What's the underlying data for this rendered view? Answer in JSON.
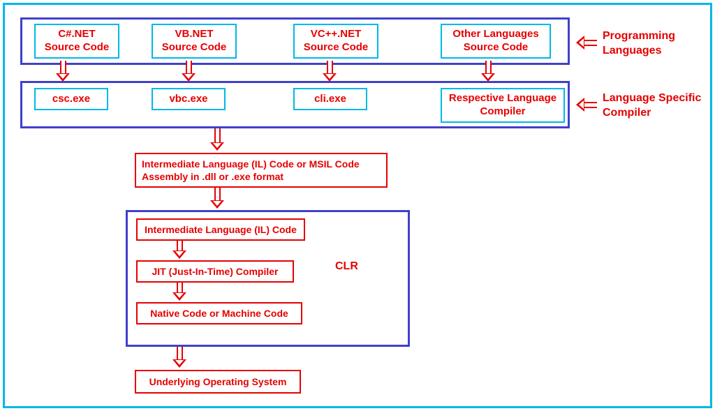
{
  "sources": {
    "csharp_l1": "C#.NET",
    "csharp_l2": "Source Code",
    "vb_l1": "VB.NET",
    "vb_l2": "Source Code",
    "vcpp_l1": "VC++.NET",
    "vcpp_l2": "Source Code",
    "other_l1": "Other Languages",
    "other_l2": "Source Code"
  },
  "compilers": {
    "csc": "csc.exe",
    "vbc": "vbc.exe",
    "cli": "cli.exe",
    "respective_l1": "Respective Language",
    "respective_l2": "Compiler"
  },
  "il_assembly_l1": "Intermediate Language (IL) Code or MSIL Code",
  "il_assembly_l2": "Assembly in .dll or .exe format",
  "clr": {
    "title": "CLR",
    "il": "Intermediate Language (IL) Code",
    "jit": "JIT (Just-In-Time) Compiler",
    "native": "Native Code or Machine Code"
  },
  "os": "Underlying Operating System",
  "labels": {
    "prog_lang_l1": "Programming",
    "prog_lang_l2": "Languages",
    "lang_comp_l1": "Language Specific",
    "lang_comp_l2": "Compiler"
  }
}
